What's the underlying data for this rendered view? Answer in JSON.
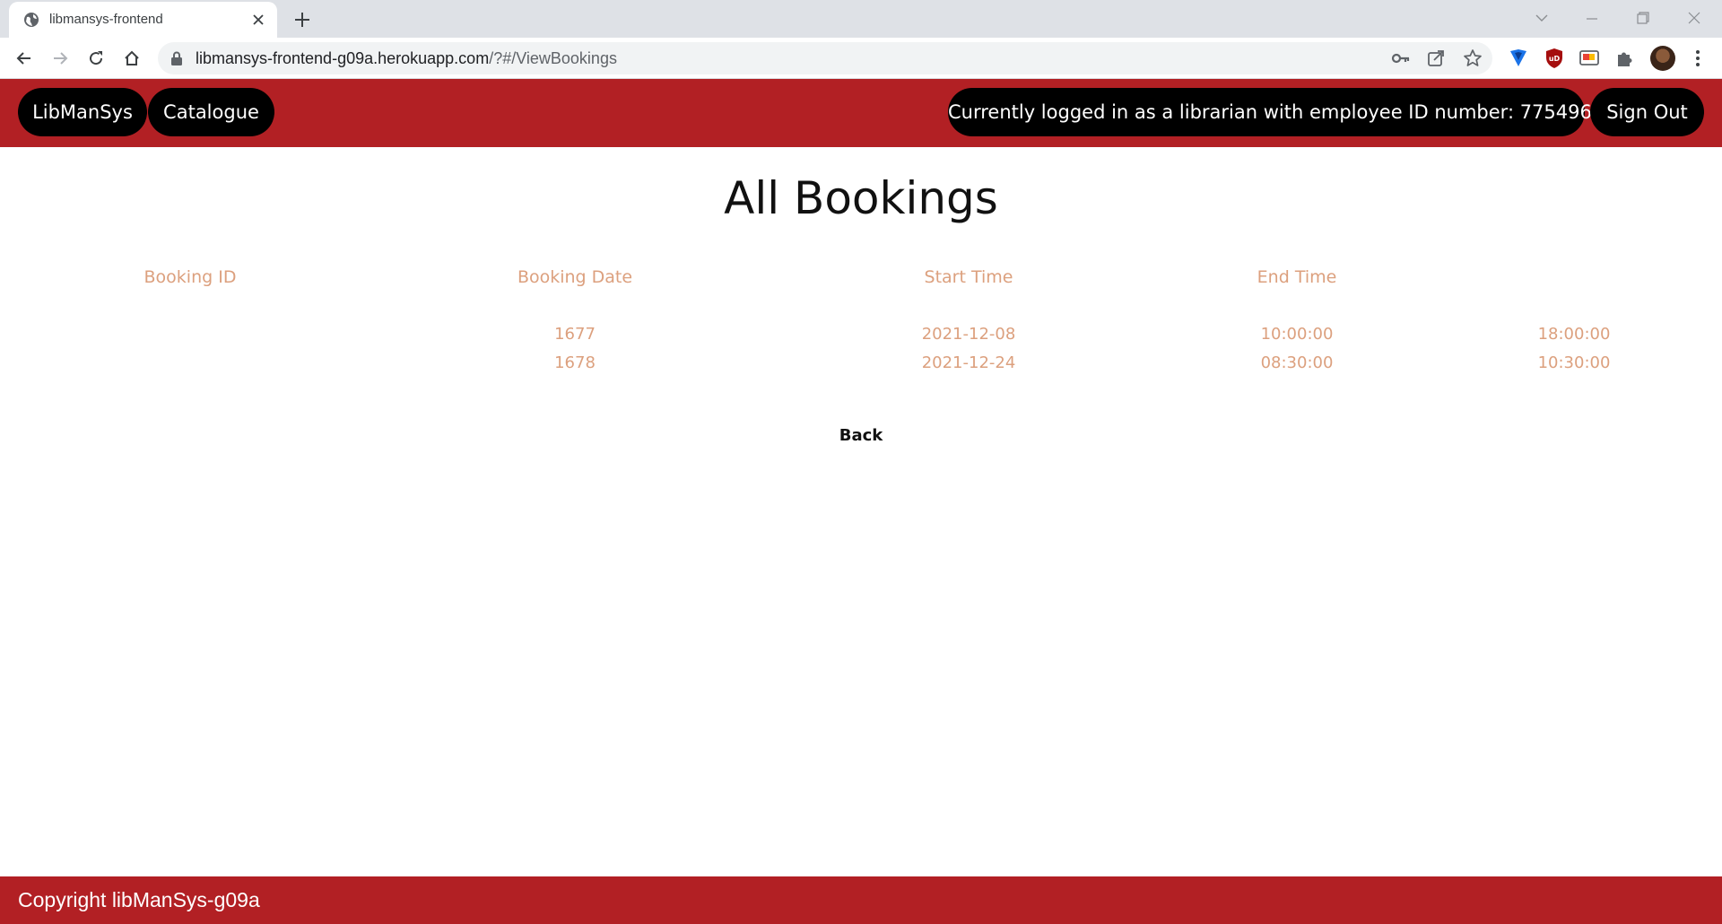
{
  "browser": {
    "tab_title": "libmansys-frontend",
    "url_domain": "libmansys-frontend-g09a.herokuapp.com",
    "url_path": "/?#/ViewBookings",
    "icons": {
      "favicon": "globe-icon",
      "close": "close-icon",
      "new_tab": "plus-icon",
      "back": "arrow-left-icon",
      "forward": "arrow-right-icon",
      "reload": "reload-icon",
      "home": "home-icon",
      "secure": "lock-icon",
      "passwords": "key-icon",
      "share": "share-icon",
      "bookmark": "star-icon",
      "extensions": [
        "shield-extension-icon",
        "ublock-icon",
        "cast-extension-icon",
        "puzzle-icon"
      ],
      "profile": "avatar",
      "menu": "kebab-menu-icon"
    }
  },
  "nav": {
    "brand": "LibManSys",
    "catalogue": "Catalogue",
    "login_status": "Currently logged in as a librarian with employee ID number: 775496",
    "sign_out": "Sign Out"
  },
  "page": {
    "title": "All Bookings",
    "back_label": "Back"
  },
  "table": {
    "headers": [
      "Booking ID",
      "Booking Date",
      "Start Time",
      "End Time"
    ],
    "rows": [
      [
        "1677",
        "2021-12-08",
        "10:00:00",
        "18:00:00"
      ],
      [
        "1678",
        "2021-12-24",
        "08:30:00",
        "10:30:00"
      ]
    ]
  },
  "footer": {
    "copyright": "Copyright libManSys-g09a"
  },
  "colors": {
    "brand_red": "#b22024",
    "pill_black": "#000000",
    "table_text": "#dca07e"
  }
}
